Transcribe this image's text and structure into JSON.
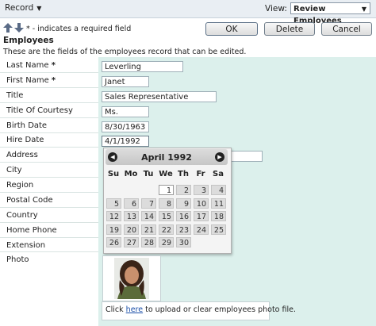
{
  "toolbar": {
    "record_label": "Record",
    "view_label": "View:",
    "view_value": "Review Employees"
  },
  "actions": {
    "required_note": "* - indicates a required field",
    "ok": "OK",
    "delete": "Delete",
    "cancel": "Cancel"
  },
  "section": {
    "title": "Employees",
    "description": "These are the fields of the employees record that can be edited."
  },
  "fields": [
    {
      "label": "Last Name",
      "required": "*",
      "value": "Leverling"
    },
    {
      "label": "First Name",
      "required": "*",
      "value": "Janet"
    },
    {
      "label": "Title",
      "required": "",
      "value": "Sales Representative"
    },
    {
      "label": "Title Of Courtesy",
      "required": "",
      "value": "Ms."
    },
    {
      "label": "Birth Date",
      "required": "",
      "value": "8/30/1963"
    },
    {
      "label": "Hire Date",
      "required": "",
      "value": "4/1/1992"
    },
    {
      "label": "Address",
      "required": "",
      "value": ""
    },
    {
      "label": "City",
      "required": "",
      "value": ""
    },
    {
      "label": "Region",
      "required": "",
      "value": ""
    },
    {
      "label": "Postal Code",
      "required": "",
      "value": ""
    },
    {
      "label": "Country",
      "required": "",
      "value": ""
    },
    {
      "label": "Home Phone",
      "required": "",
      "value": ""
    },
    {
      "label": "Extension",
      "required": "",
      "value": ""
    },
    {
      "label": "Photo",
      "required": "",
      "value": ""
    }
  ],
  "calendar": {
    "title": "April 1992",
    "weekdays": [
      "Su",
      "Mo",
      "Tu",
      "We",
      "Th",
      "Fr",
      "Sa"
    ],
    "weeks": [
      [
        "",
        "",
        "",
        "1",
        "2",
        "3",
        "4"
      ],
      [
        "5",
        "6",
        "7",
        "8",
        "9",
        "10",
        "11"
      ],
      [
        "12",
        "13",
        "14",
        "15",
        "16",
        "17",
        "18"
      ],
      [
        "19",
        "20",
        "21",
        "22",
        "23",
        "24",
        "25"
      ],
      [
        "26",
        "27",
        "28",
        "29",
        "30",
        "",
        ""
      ]
    ],
    "selected": "1"
  },
  "photo": {
    "upload_prefix": "Click ",
    "upload_link": "here",
    "upload_suffix": " to upload or clear employees photo file."
  },
  "colors": {
    "value_bg": "#dcf0ec",
    "toolbar_bg": "#e9eef3",
    "link": "#1a4ea8"
  },
  "icons": [
    "caret-down-icon",
    "arrow-up-icon",
    "arrow-down-icon",
    "prev-month-icon",
    "next-month-icon"
  ]
}
